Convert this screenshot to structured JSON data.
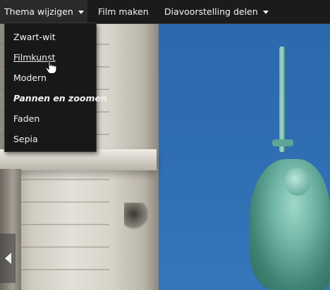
{
  "toolbar": {
    "theme_label": "Thema wijzigen",
    "film_label": "Film maken",
    "slideshow_label": "Diavoorstelling delen"
  },
  "theme_menu": {
    "items": [
      {
        "label": "Zwart-wit"
      },
      {
        "label": "Filmkunst"
      },
      {
        "label": "Modern"
      },
      {
        "label": "Pannen en zoomen"
      },
      {
        "label": "Faden"
      },
      {
        "label": "Sepia"
      }
    ]
  },
  "icons": {
    "dropdown_caret": "chevron-down-icon",
    "cursor": "hand-pointer-icon",
    "prev": "chevron-left-icon"
  }
}
